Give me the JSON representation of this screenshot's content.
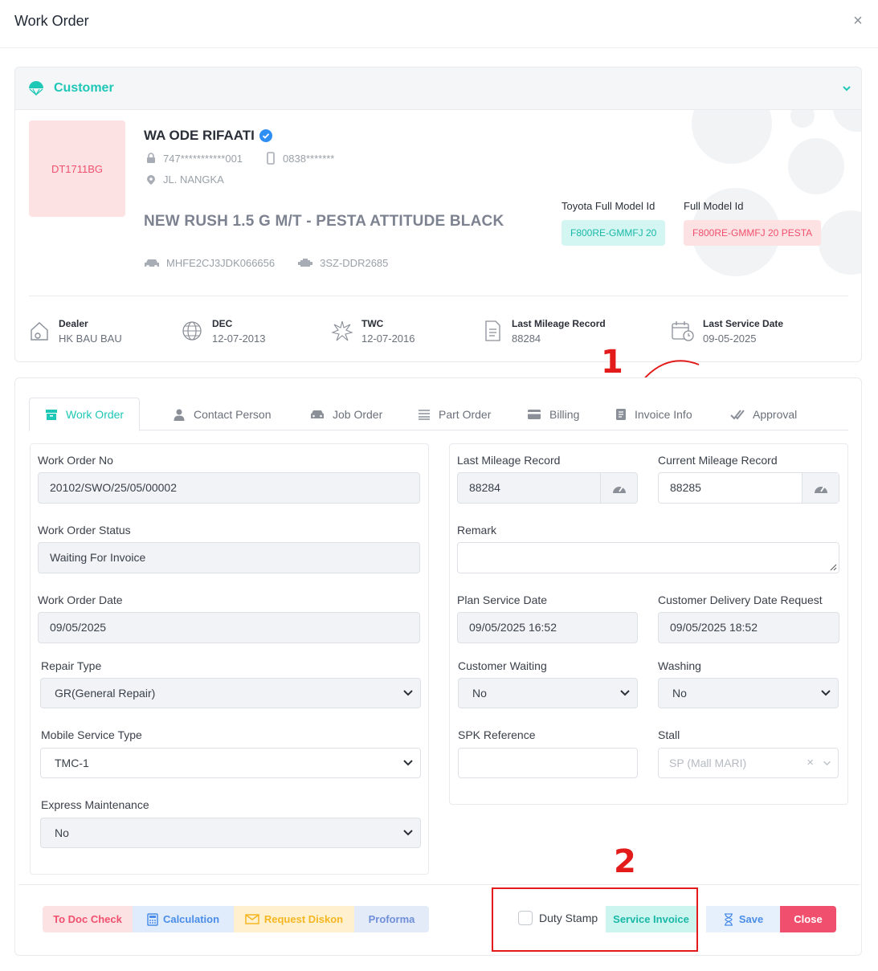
{
  "modal": {
    "title": "Work Order",
    "close": "×"
  },
  "customer": {
    "header": "Customer",
    "plate": "DT1711BG",
    "name": "WA ODE RIFAATI",
    "id_masked": "747***********001",
    "phone_masked": "0838*******",
    "address": "JL. NANGKA",
    "vehicle_model": "NEW RUSH 1.5 G M/T - PESTA ATTITUDE BLACK",
    "vin": "MHFE2CJ3JDK066656",
    "engine": "3SZ-DDR2685",
    "toyota_full_model_label": "Toyota Full Model Id",
    "toyota_full_model": "F800RE-GMMFJ 20",
    "full_model_label": "Full Model Id",
    "full_model": "F800RE-GMMFJ 20 PESTA",
    "stats": [
      {
        "label": "Dealer",
        "value": "HK BAU BAU"
      },
      {
        "label": "DEC",
        "value": "12-07-2013"
      },
      {
        "label": "TWC",
        "value": "12-07-2016"
      },
      {
        "label": "Last Mileage Record",
        "value": "88284"
      },
      {
        "label": "Last Service Date",
        "value": "09-05-2025"
      }
    ]
  },
  "annotations": {
    "one": "1",
    "two": "2"
  },
  "tabs": [
    {
      "label": "Work Order",
      "icon": "archive-icon",
      "active": true
    },
    {
      "label": "Contact Person",
      "icon": "user-icon"
    },
    {
      "label": "Job Order",
      "icon": "car-icon"
    },
    {
      "label": "Part Order",
      "icon": "list-icon"
    },
    {
      "label": "Billing",
      "icon": "credit-card-icon"
    },
    {
      "label": "Invoice Info",
      "icon": "document-icon"
    },
    {
      "label": "Approval",
      "icon": "double-check-icon"
    }
  ],
  "form": {
    "wo_no_label": "Work Order No",
    "wo_no": "20102/SWO/25/05/00002",
    "wo_status_label": "Work Order Status",
    "wo_status": "Waiting For Invoice",
    "wo_date_label": "Work Order Date",
    "wo_date": "09/05/2025",
    "repair_type_label": "Repair Type",
    "repair_type": "GR(General Repair)",
    "mobile_service_label": "Mobile Service Type",
    "mobile_service": "TMC-1",
    "express_label": "Express Maintenance",
    "express": "No",
    "last_mileage_label": "Last Mileage Record",
    "last_mileage": "88284",
    "current_mileage_label": "Current Mileage Record",
    "current_mileage": "88285",
    "remark_label": "Remark",
    "remark": "",
    "plan_service_label": "Plan Service Date",
    "plan_service": "09/05/2025 16:52",
    "delivery_label": "Customer Delivery Date Request",
    "delivery": "09/05/2025 18:52",
    "cust_waiting_label": "Customer Waiting",
    "cust_waiting": "No",
    "washing_label": "Washing",
    "washing": "No",
    "spk_label": "SPK Reference",
    "spk": "",
    "stall_label": "Stall",
    "stall": "SP (Mall MARI)"
  },
  "footer": {
    "to_doc_check": "To Doc Check",
    "calculation": "Calculation",
    "request_diskon": "Request Diskon",
    "proforma": "Proforma",
    "duty_stamp": "Duty Stamp",
    "service_invoice": "Service Invoice",
    "save": "Save",
    "close": "Close"
  },
  "colors": {
    "accent": "#1ec7b6",
    "danger": "#f0506e",
    "annotation": "#e31b1b"
  }
}
